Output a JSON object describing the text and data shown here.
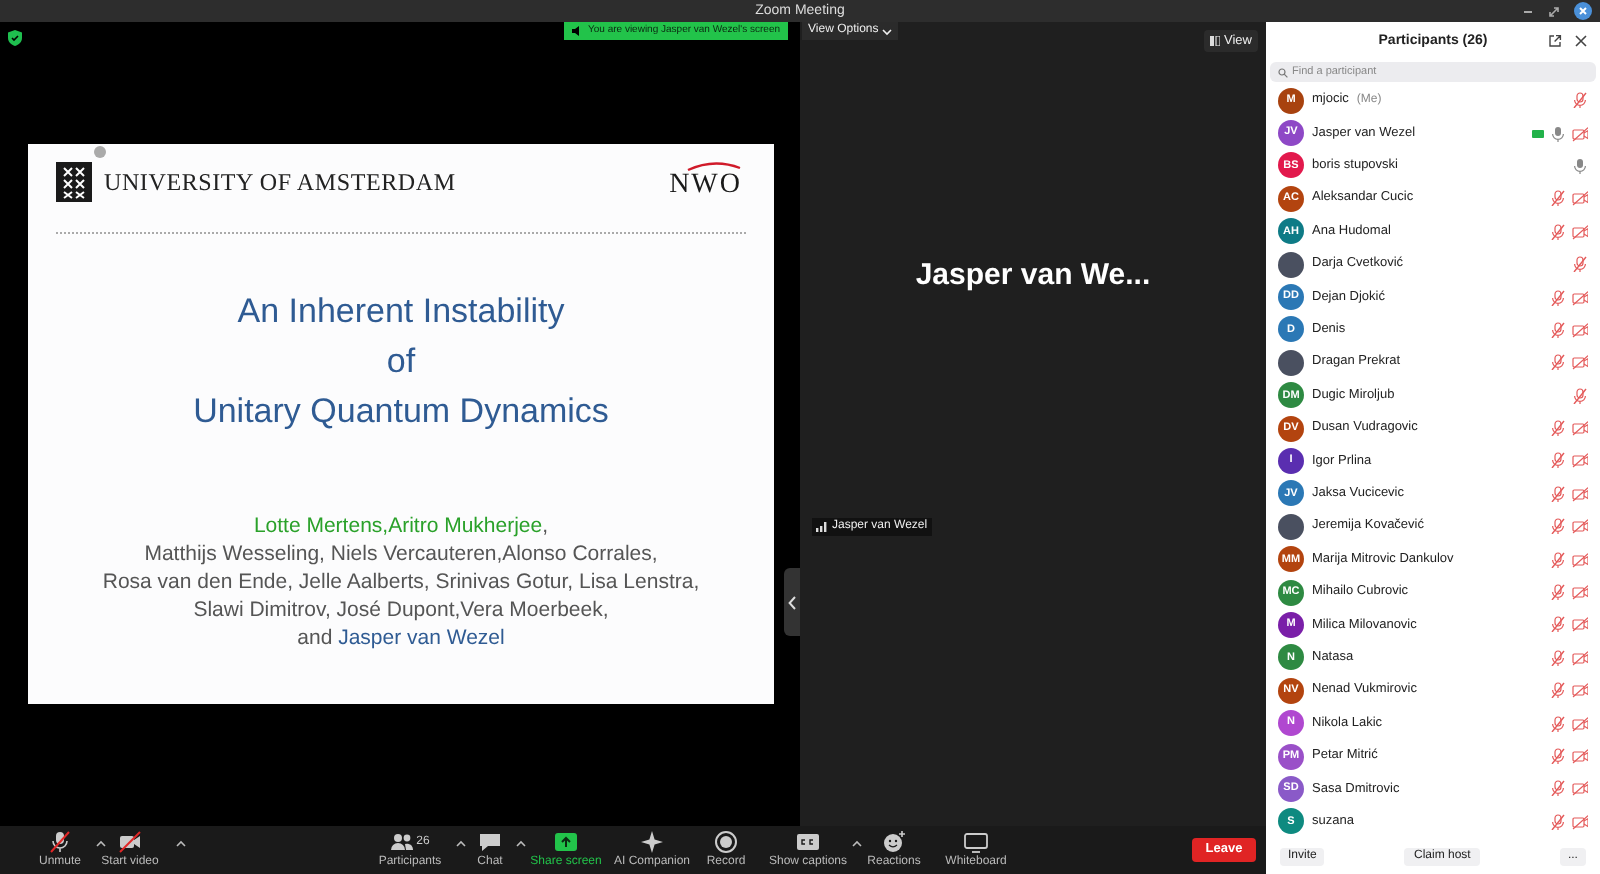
{
  "window": {
    "title": "Zoom Meeting"
  },
  "share_banner": {
    "text": "You are viewing Jasper van Wezel's screen",
    "view_options": "View Options"
  },
  "slide": {
    "institution": "UNIVERSITY OF AMSTERDAM",
    "funder": "NWO",
    "title_lines": [
      "An Inherent Instability",
      "of",
      "Unitary Quantum Dynamics"
    ],
    "author_lines": [
      [
        {
          "text": "Lotte Mertens,Aritro Mukherjee",
          "kind": "lead"
        },
        {
          "text": ",",
          "kind": "plain"
        }
      ],
      [
        {
          "text": "Matthijs Wesseling, Niels Vercauteren,Alonso Corrales,",
          "kind": "plain"
        }
      ],
      [
        {
          "text": "Rosa van den Ende, Jelle Aalberts, Srinivas Gotur, Lisa Lenstra,",
          "kind": "plain"
        }
      ],
      [
        {
          "text": "Slawi Dimitrov, José Dupont,Vera Moerbeek,",
          "kind": "plain"
        }
      ],
      [
        {
          "text": "and ",
          "kind": "plain"
        },
        {
          "text": "Jasper van Wezel",
          "kind": "presenter"
        }
      ]
    ]
  },
  "video": {
    "view_button": "View",
    "display_name": "Jasper van We...",
    "name_tag": "Jasper van Wezel"
  },
  "toolbar": {
    "items": [
      {
        "kind": "mic",
        "label": "Unmute",
        "has_menu": true
      },
      {
        "kind": "video",
        "label": "Start video",
        "has_menu": true
      },
      {
        "kind": "participants",
        "label": "Participants",
        "count": "26",
        "has_menu": true
      },
      {
        "kind": "chat",
        "label": "Chat",
        "has_menu": true
      },
      {
        "kind": "share",
        "label": "Share screen",
        "has_menu": false
      },
      {
        "kind": "ai",
        "label": "AI Companion",
        "has_menu": false
      },
      {
        "kind": "record",
        "label": "Record",
        "has_menu": false
      },
      {
        "kind": "captions",
        "label": "Show captions",
        "has_menu": true
      },
      {
        "kind": "reactions",
        "label": "Reactions",
        "has_menu": false
      },
      {
        "kind": "whiteboard",
        "label": "Whiteboard",
        "has_menu": false
      }
    ],
    "leave": "Leave"
  },
  "participants_panel": {
    "title": "Participants (26)",
    "search": {
      "placeholder": "Find a participant"
    },
    "participants": [
      {
        "name": "mjocic",
        "note": "(Me)",
        "avatar": {
          "kind": "initials",
          "initials": "M",
          "color": "#a8420f"
        },
        "mic_muted": true,
        "video_off": false,
        "sharing": false
      },
      {
        "name": "Jasper van Wezel",
        "avatar": {
          "kind": "initials",
          "initials": "JV",
          "color": "#8e48c6"
        },
        "mic_muted": false,
        "video_off": true,
        "sharing": true
      },
      {
        "name": "boris stupovski",
        "avatar": {
          "kind": "initials",
          "initials": "BS",
          "color": "#e2194c"
        },
        "mic_muted": false,
        "video_off": false,
        "sharing": false
      },
      {
        "name": "Aleksandar Cucic",
        "avatar": {
          "kind": "initials",
          "initials": "AC",
          "color": "#b3440f"
        },
        "mic_muted": true,
        "video_off": true,
        "sharing": false
      },
      {
        "name": "Ana Hudomal",
        "avatar": {
          "kind": "initials",
          "initials": "AH",
          "color": "#0e7b86"
        },
        "mic_muted": true,
        "video_off": true,
        "sharing": false
      },
      {
        "name": "Darja Cvetković",
        "avatar": {
          "kind": "photo"
        },
        "mic_muted": true,
        "video_off": false,
        "sharing": false
      },
      {
        "name": "Dejan Djokić",
        "avatar": {
          "kind": "initials",
          "initials": "DD",
          "color": "#2b78b5"
        },
        "mic_muted": true,
        "video_off": true,
        "sharing": false
      },
      {
        "name": "Denis",
        "avatar": {
          "kind": "initials",
          "initials": "D",
          "color": "#2b78b5"
        },
        "mic_muted": true,
        "video_off": true,
        "sharing": false
      },
      {
        "name": "Dragan Prekrat",
        "avatar": {
          "kind": "photo"
        },
        "mic_muted": true,
        "video_off": true,
        "sharing": false
      },
      {
        "name": "Dugic Miroljub",
        "avatar": {
          "kind": "initials",
          "initials": "DM",
          "color": "#2e8a42"
        },
        "mic_muted": true,
        "video_off": false,
        "sharing": false
      },
      {
        "name": "Dusan Vudragovic",
        "avatar": {
          "kind": "initials",
          "initials": "DV",
          "color": "#b3440f"
        },
        "mic_muted": true,
        "video_off": true,
        "sharing": false
      },
      {
        "name": "Igor Prlina",
        "avatar": {
          "kind": "initials",
          "initials": "I",
          "color": "#5a2eb0"
        },
        "mic_muted": true,
        "video_off": true,
        "sharing": false
      },
      {
        "name": "Jaksa Vucicevic",
        "avatar": {
          "kind": "initials",
          "initials": "JV",
          "color": "#2b78b5"
        },
        "mic_muted": true,
        "video_off": true,
        "sharing": false
      },
      {
        "name": "Jeremija Kovačević",
        "avatar": {
          "kind": "photo"
        },
        "mic_muted": true,
        "video_off": true,
        "sharing": false
      },
      {
        "name": "Marija Mitrovic Dankulov",
        "avatar": {
          "kind": "initials",
          "initials": "MM",
          "color": "#b3440f"
        },
        "mic_muted": true,
        "video_off": true,
        "sharing": false
      },
      {
        "name": "Mihailo Cubrovic",
        "avatar": {
          "kind": "initials",
          "initials": "MC",
          "color": "#2e8a42"
        },
        "mic_muted": true,
        "video_off": true,
        "sharing": false
      },
      {
        "name": "Milica Milovanovic",
        "avatar": {
          "kind": "initials",
          "initials": "M",
          "color": "#7a1fa8"
        },
        "mic_muted": true,
        "video_off": true,
        "sharing": false
      },
      {
        "name": "Natasa",
        "avatar": {
          "kind": "initials",
          "initials": "N",
          "color": "#2e8a42"
        },
        "mic_muted": true,
        "video_off": true,
        "sharing": false
      },
      {
        "name": "Nenad Vukmirovic",
        "avatar": {
          "kind": "initials",
          "initials": "NV",
          "color": "#b3440f"
        },
        "mic_muted": true,
        "video_off": true,
        "sharing": false
      },
      {
        "name": "Nikola Lakic",
        "avatar": {
          "kind": "initials",
          "initials": "N",
          "color": "#b048d0"
        },
        "mic_muted": true,
        "video_off": true,
        "sharing": false
      },
      {
        "name": "Petar Mitrić",
        "avatar": {
          "kind": "initials",
          "initials": "PM",
          "color": "#9a50c8"
        },
        "mic_muted": true,
        "video_off": true,
        "sharing": false
      },
      {
        "name": "Sasa Dmitrovic",
        "avatar": {
          "kind": "initials",
          "initials": "SD",
          "color": "#8a5ac8"
        },
        "mic_muted": true,
        "video_off": true,
        "sharing": false
      },
      {
        "name": "suzana",
        "avatar": {
          "kind": "initials",
          "initials": "S",
          "color": "#0e8a80"
        },
        "mic_muted": true,
        "video_off": true,
        "sharing": false
      }
    ],
    "footer": {
      "invite": "Invite",
      "claim_host": "Claim host",
      "more": "..."
    }
  }
}
